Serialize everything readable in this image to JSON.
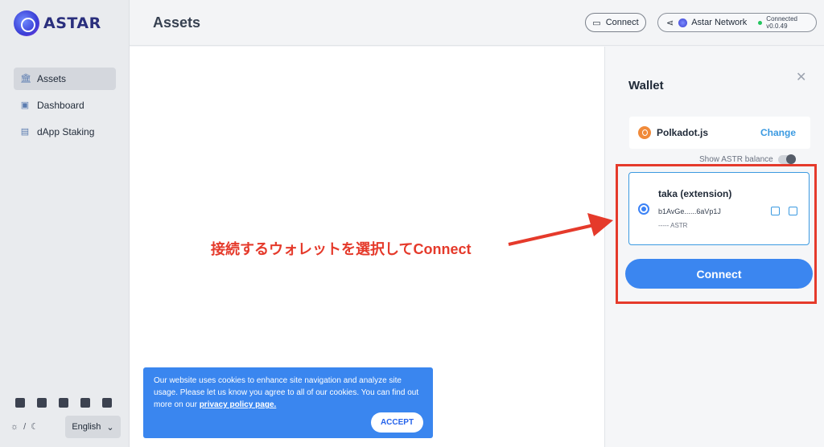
{
  "brand": {
    "name": "ASTAR"
  },
  "sidebar": {
    "items": [
      {
        "label": "Assets",
        "icon": "bank-icon",
        "active": true
      },
      {
        "label": "Dashboard",
        "icon": "dashboard-icon"
      },
      {
        "label": "dApp Staking",
        "icon": "staking-icon"
      }
    ],
    "socials": [
      "twitter-icon",
      "telegram-icon",
      "discord-icon",
      "github-icon",
      "docs-icon"
    ],
    "theme_separator": "/",
    "language": "English"
  },
  "header": {
    "title": "Assets",
    "connect_label": "Connect",
    "network_name": "Astar Network",
    "status_label": "Connected",
    "version": "v0.0.49",
    "status_color": "#22c55e"
  },
  "wallet": {
    "title": "Wallet",
    "extension_name": "Polkadot.js",
    "change_label": "Change",
    "show_balance_label": "Show ASTR balance",
    "account": {
      "name": "taka (extension)",
      "address": "b1AvGe......6aVp1J",
      "balance": "----- ASTR"
    },
    "connect_label": "Connect",
    "accent": "#3b86f0"
  },
  "annotation": {
    "text": "接続するウォレットを選択してConnect",
    "color": "#e53a2b"
  },
  "cookie": {
    "text": "Our website uses cookies to enhance site navigation and analyze site usage. Please let us know you agree to all of our cookies. You can find out more on our",
    "link": "privacy policy page.",
    "accept_label": "ACCEPT"
  }
}
